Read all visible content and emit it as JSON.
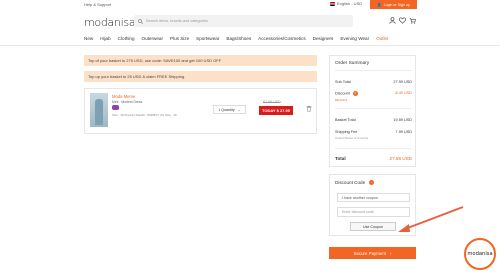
{
  "topbar": {
    "help": "Help & Support",
    "language": "English - USD",
    "login_label": "Login or Sign up"
  },
  "header": {
    "logo": "modanisa",
    "search_placeholder": "Search items, brands and categories"
  },
  "nav": {
    "items": [
      "New",
      "Hijab",
      "Clothing",
      "Outerwear",
      "Plus Size",
      "Sportswear",
      "Bags/Shoes",
      "Accessories/Cosmetics",
      "Designers",
      "Evening Wear",
      "Outlet"
    ]
  },
  "banners": {
    "coupon": "Top of your basket to 275 USD, use code: SAVE100 and get 100 USD OFF",
    "shipping": "Top up your basket to 25 USD & claim FREE Shipping."
  },
  "product": {
    "name": "Moda Merve",
    "brand": "Mint - Modest Dress",
    "size_info": "Size : 40   Product Details : 8028871   US Size : 10",
    "quantity_label": "1 Quantity",
    "old_price": "$7.99 USD",
    "today_price": "TODAY $ 27.99"
  },
  "summary": {
    "title": "Order Summary",
    "subtotal_label": "Sub Total",
    "subtotal_value": "27.99 USD",
    "discount_label": "Discount",
    "discount_value": "-8.40 USD",
    "details_label": "DETAILS",
    "basket_total_label": "Basket Total",
    "basket_total_value": "19.59 USD",
    "shipping_label": "Shipping Fee",
    "shipping_value": "7.99 USD",
    "shipping_note": "United States of America",
    "total_label": "Total",
    "total_value": "27.58 USD"
  },
  "discount_code": {
    "title": "Discount Code",
    "select_value": "I have another coupon",
    "input_placeholder": "Enter discount code",
    "button_label": "Use Coupon"
  },
  "checkout": {
    "button_label": "Secure Payment"
  },
  "float_logo": "modanisa",
  "colors": {
    "accent": "#f26522",
    "sale_red": "#d91b1b",
    "banner_bg": "#fde0c8"
  }
}
